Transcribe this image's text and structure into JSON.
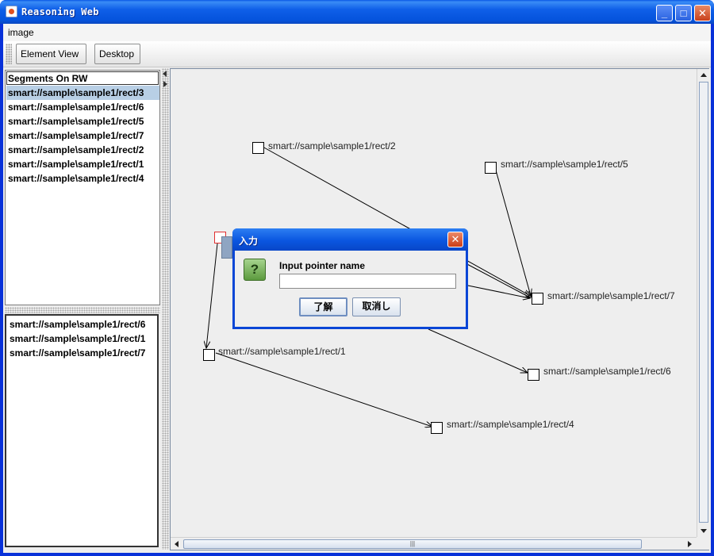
{
  "window": {
    "title": "Reasoning Web"
  },
  "menu": {
    "items": [
      "image"
    ]
  },
  "toolbar": {
    "element_view": "Element View",
    "desktop": "Desktop"
  },
  "segments_list": {
    "header": "Segments On RW",
    "items": [
      "smart://sample\\sample1/rect/3",
      "smart://sample\\sample1/rect/6",
      "smart://sample\\sample1/rect/5",
      "smart://sample\\sample1/rect/7",
      "smart://sample\\sample1/rect/2",
      "smart://sample\\sample1/rect/1",
      "smart://sample\\sample1/rect/4"
    ],
    "selected_index": 0
  },
  "lower_list": {
    "items": [
      "smart://sample\\sample1/rect/6",
      "smart://sample\\sample1/rect/1",
      "smart://sample\\sample1/rect/7"
    ]
  },
  "graph": {
    "nodes": [
      {
        "id": "rect2",
        "label": "smart://sample\\sample1/rect/2"
      },
      {
        "id": "rect5",
        "label": "smart://sample\\sample1/rect/5"
      },
      {
        "id": "rect7",
        "label": "smart://sample\\sample1/rect/7"
      },
      {
        "id": "rect1",
        "label": "smart://sample\\sample1/rect/1"
      },
      {
        "id": "rect6",
        "label": "smart://sample\\sample1/rect/6"
      },
      {
        "id": "rect4",
        "label": "smart://sample\\sample1/rect/4"
      },
      {
        "id": "rect3",
        "label": ""
      }
    ]
  },
  "dialog": {
    "title": "入力",
    "prompt": "Input pointer name",
    "input_value": "",
    "ok_label": "了解",
    "cancel_label": "取消し"
  },
  "icons": {
    "app": "java-cup-icon",
    "question": "question-icon"
  },
  "colors": {
    "titlebar": "#0a58e6",
    "selection": "#b8cfe5",
    "close_button": "#cc3d18",
    "selected_node_border": "#e03030"
  }
}
